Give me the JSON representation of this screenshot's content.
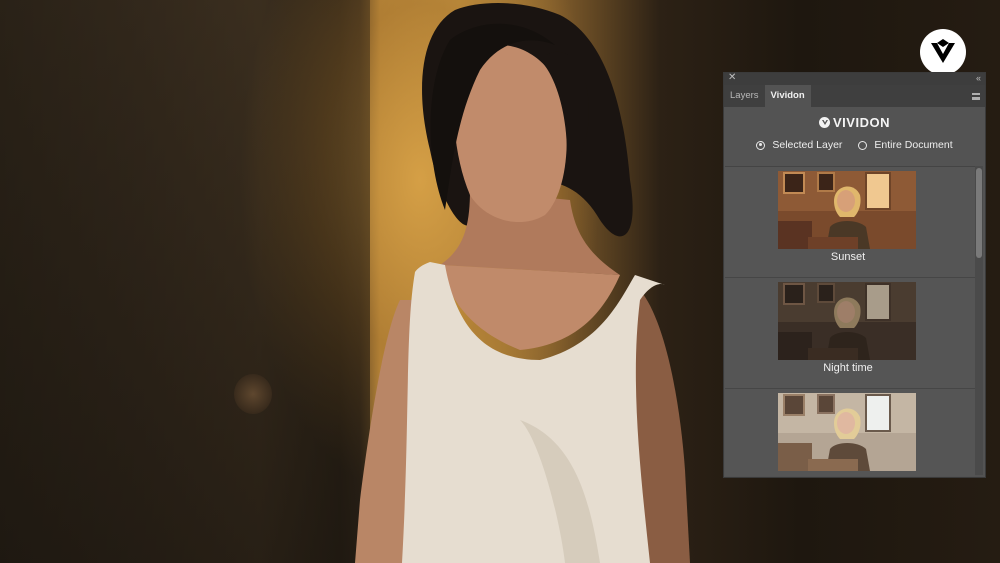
{
  "panel": {
    "tabs": [
      {
        "label": "Layers",
        "active": false
      },
      {
        "label": "Vividon",
        "active": true
      }
    ],
    "brand": "VIVIDON",
    "scope_options": [
      {
        "label": "Selected Layer",
        "checked": true
      },
      {
        "label": "Entire Document",
        "checked": false
      }
    ],
    "presets": [
      {
        "label": "Sunset"
      },
      {
        "label": "Night time"
      },
      {
        "label": ""
      }
    ]
  },
  "colors": {
    "panel_bg": "#535353",
    "tab_bar": "#3f3f3f",
    "text": "#f0f0f0"
  },
  "icons": [
    "close-icon",
    "collapse-icon",
    "panel-menu-icon",
    "vividon-logo-icon",
    "brand-badge-icon"
  ]
}
